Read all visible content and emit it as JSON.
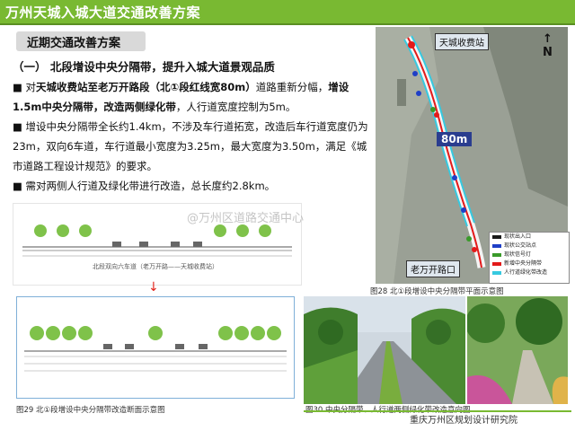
{
  "header": {
    "title": "万州天城入城大道交通改善方案"
  },
  "section": {
    "tag": "近期交通改善方案"
  },
  "content": {
    "heading": "（一） 北段增设中央分隔带，提升入城大道景观品质",
    "p1_pre": "■ 对",
    "p1_b1": "天城收费站至老万开路段（北①段红线宽80m）",
    "p1_mid": "道路重新分幅，",
    "p1_b2": "增设1.5m中央分隔带，改造两侧绿化带",
    "p1_post": "，人行道宽度控制为5m。",
    "p2": "■ 增设中央分隔带全长约1.4km，不涉及车行道拓宽，改造后车行道宽度仍为23m，双向6车道，车行道最小宽度为3.25m，最大宽度为3.50m，满足《城市道路工程设计规范》的要求。",
    "p3": "■ 需对两侧人行道及绿化带进行改造，总长度约2.8km。"
  },
  "map": {
    "label_top": "天城收费站",
    "label_bottom": "老万开路口",
    "label_80m": "80m",
    "compass": "N",
    "legend": [
      {
        "label": "现状出入口",
        "color": "#1a1a1a"
      },
      {
        "label": "现状公交站点",
        "color": "#1f3fc7"
      },
      {
        "label": "现状信号灯",
        "color": "#3a9a2a"
      },
      {
        "label": "新增中央分隔带",
        "color": "#e31a1a"
      },
      {
        "label": "人行道绿化带改造",
        "color": "#36c9e0"
      }
    ]
  },
  "captions": {
    "fig28": "图28  北①段增设中央分隔带平面示意图",
    "fig29": "图29  北①段增设中央分隔带改造断面示意图",
    "fig30": "图30  中央分隔带、人行道两侧绿化带改造意向图"
  },
  "section_text": "北段双向六车道（老万开路——天城收费站）",
  "watermark": "@万州区道路交通中心",
  "footer": "重庆万州区规划设计研究院"
}
